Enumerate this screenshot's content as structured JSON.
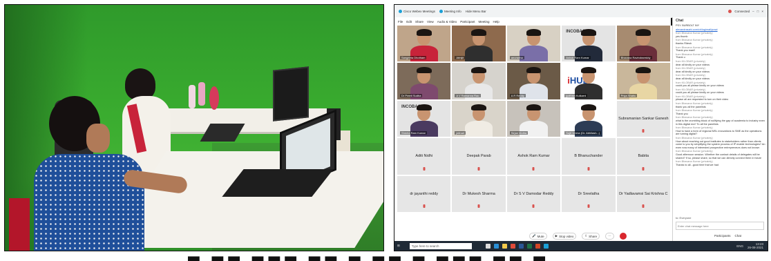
{
  "titlebar": {
    "app": "Cisco Webex Meetings",
    "meeting_info": "Meeting Info",
    "hide_menu": "Hide Menu Bar",
    "connected": "Connected"
  },
  "menu": [
    "File",
    "Edit",
    "Share",
    "View",
    "Audio & Video",
    "Participant",
    "Meeting",
    "Help"
  ],
  "tiles": [
    {
      "caption": "Sangeeta Dhotham",
      "type": "video",
      "bg": "#bfa58a",
      "torso": "#c8233a"
    },
    {
      "caption": "Abhijit",
      "type": "video",
      "bg": "#8e6a4d",
      "torso": "#2f2f2f"
    },
    {
      "caption": "anuradha",
      "type": "video",
      "bg": "#d8d1c4",
      "torso": "#7a6fa8"
    },
    {
      "caption": "Ashok Ram Kumar",
      "type": "video",
      "bg": "#e4e4e4",
      "torso": "#222a3a",
      "logo": "INCOBACT"
    },
    {
      "caption": "Bhavana Ravindrareddy",
      "type": "video",
      "bg": "#a78b70",
      "torso": "#6a2e3a"
    },
    {
      "caption": "Dr Preeti Sudha",
      "type": "video",
      "bg": "#7d6b5a",
      "torso": "#7e4a6e"
    },
    {
      "caption": "A V Ramanna Rao",
      "type": "video",
      "bg": "#d6d3cd",
      "torso": "#e8e8e8"
    },
    {
      "caption": "A R Reddy",
      "type": "video",
      "bg": "#6b5a47",
      "torso": "#dfe3ea"
    },
    {
      "caption": "jyothish Kulkarni",
      "type": "video",
      "bg": "#ffffff",
      "torso": "#2f2f2f",
      "hub": true
    },
    {
      "caption": "Priya Shahu",
      "type": "video",
      "bg": "#c9b79b",
      "torso": "#e8d6a4"
    },
    {
      "caption": "Sheela Ram Kumar",
      "type": "video",
      "bg": "#e4e4e4",
      "torso": "#4a3a60",
      "logo": "INCOBACT"
    },
    {
      "caption": "jatinart",
      "type": "video",
      "bg": "#d9d4ca",
      "torso": "#f0ece4"
    },
    {
      "caption": "Sirjan Moitra",
      "type": "video",
      "bg": "#c7c2bb",
      "torso": "#f1f1f1"
    },
    {
      "caption": "Sujit Verma (Dr. Abhilash...)",
      "type": "video",
      "bg": "#ffffff",
      "torso": "#2d3c55"
    },
    {
      "caption": "Subramanian Sankar Ganesh",
      "type": "name"
    },
    {
      "caption": "Aditi Nidhi",
      "type": "name"
    },
    {
      "caption": "Deepak Parab",
      "type": "name"
    },
    {
      "caption": "Ashok Ram Kumar",
      "type": "name"
    },
    {
      "caption": "B Bhanuchander",
      "type": "name"
    },
    {
      "caption": "Babita",
      "type": "name"
    },
    {
      "caption": "dr jayanthi reddy",
      "type": "name"
    },
    {
      "caption": "Dr Mukesh Sharma",
      "type": "name"
    },
    {
      "caption": "Dr S V Damodar Reddy",
      "type": "name"
    },
    {
      "caption": "Dr Sreelatha",
      "type": "name"
    },
    {
      "caption": "Dr Yadlavamsi Sai Krishna C",
      "type": "name"
    }
  ],
  "chat": {
    "header": "Chat",
    "messages": [
      {
        "from": "",
        "text": "PSY. BURBOLT INY"
      },
      {
        "from": "",
        "text": "alexandrasahi.com/ch/log/mail/pract",
        "link": true
      },
      {
        "from": "from Bhavana Kumar (privately)",
        "text": "yes thumb"
      },
      {
        "from": "from Bhavana Kumar (privately)",
        "text": "thanks Ritesh"
      },
      {
        "from": "from Bhavana Kumar (privately)",
        "text": "Thank you man!!"
      },
      {
        "from": "from Bhavana Kumar (privately)",
        "text": "Thank u"
      },
      {
        "from": "from KILOBAR (privately)",
        "text": "dear all kindly on your videos"
      },
      {
        "from": "from KILOBAR (privately)",
        "text": "dear all kindly on your videos"
      },
      {
        "from": "from KILOBAR (privately)",
        "text": "dear all kindly on your videos"
      },
      {
        "from": "from KILOBAR (privately)",
        "text": "could you all please kindly on your videos"
      },
      {
        "from": "from KILOBAR (privately)",
        "text": "could you all please kindly on your videos"
      },
      {
        "from": "from KILOBAR (privately)",
        "text": "please all are requested to turn on their video"
      },
      {
        "from": "from Bhavana Kumar (privately)",
        "text": "thank you all the panelists"
      },
      {
        "from": "from Bhavana Kumar (privately)",
        "text": "Thank you"
      },
      {
        "from": "from Bhavana Kumar (privately)",
        "text": "what is the crumbling block of nullifying the gap of academia to industry even in this digital era? To all the panelists"
      },
      {
        "from": "from Bhavana Kumar (privately)",
        "text": "How to have a form of regional MSL innovations to SME as the operations are turning digital?"
      },
      {
        "from": "from Bhavana Kumar (privately)",
        "text": "How about reaching out good institutes to stakeholders rather than clients come to you by simplifying the system process of IP enable technologies? An even now many of interested prospective entrepreneurs does not known"
      },
      {
        "from": "from Bhavana Kumar (privately)",
        "text": "Good afternoon session. Whether the contact details of delegates will be shared? If so, please share, so that we can directly connect them in future"
      },
      {
        "from": "from Bhavana Kumar (privately)",
        "text": "Thanks to all...good time that we had"
      }
    ],
    "to_label": "to: Everyone",
    "input_placeholder": "Enter chat message here",
    "participants_label": "Participants",
    "chat_label": "Chat"
  },
  "controls": {
    "mute": "Mute",
    "stop_video": "Stop video",
    "share": "Share"
  },
  "taskbar": {
    "search_placeholder": "Type here to search",
    "time": "13:23",
    "date": "26-08-2021",
    "lang": "ENG"
  },
  "colors": {
    "accent": "#1ba0d7",
    "end_call": "#d9272e",
    "greenscreen": "#3aac2f"
  }
}
